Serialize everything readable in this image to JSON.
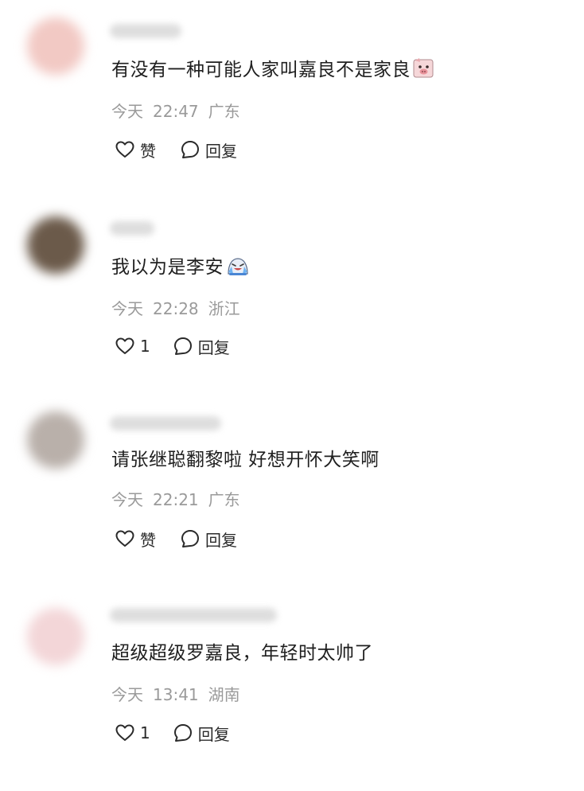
{
  "comments": [
    {
      "text": "有没有一种可能人家叫嘉良不是家良",
      "emoji": "pig-face-emoji",
      "date": "今天",
      "time": "22:47",
      "location": "广东",
      "like_label": "赞",
      "reply_label": "回复",
      "avatar_color": "#f2c9c4"
    },
    {
      "text": "我以为是李安",
      "emoji": "laughing-crying-emoji",
      "date": "今天",
      "time": "22:28",
      "location": "浙江",
      "like_label": "1",
      "reply_label": "回复",
      "avatar_color": "#6b5a4a"
    },
    {
      "text": "请张继聪翻黎啦 好想开怀大笑啊",
      "emoji": "",
      "date": "今天",
      "time": "22:21",
      "location": "广东",
      "like_label": "赞",
      "reply_label": "回复",
      "avatar_color": "#b9b0aa"
    },
    {
      "text": "超级超级罗嘉良，年轻时太帅了",
      "emoji": "",
      "date": "今天",
      "time": "13:41",
      "location": "湖南",
      "like_label": "1",
      "reply_label": "回复",
      "avatar_color": "#f3d6d8"
    }
  ]
}
